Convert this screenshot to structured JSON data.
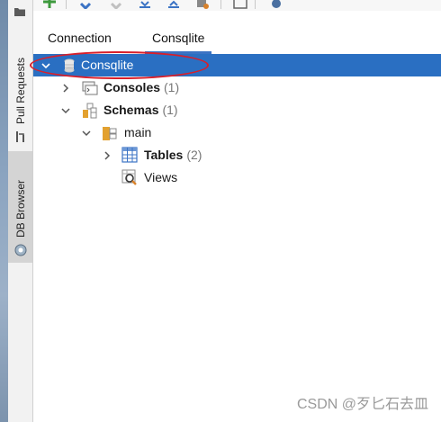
{
  "side_panel": {
    "pull_requests_label": "Pull Requests",
    "db_browser_label": "DB Browser"
  },
  "tabs": [
    {
      "label": "Connection"
    },
    {
      "label": "Consqlite"
    }
  ],
  "tree": {
    "root": {
      "label": "Consqlite"
    },
    "consoles": {
      "label": "Consoles",
      "count": "(1)"
    },
    "schemas": {
      "label": "Schemas",
      "count": "(1)"
    },
    "main": {
      "label": "main"
    },
    "tables": {
      "label": "Tables",
      "count": "(2)"
    },
    "views": {
      "label": "Views"
    }
  },
  "watermark": "CSDN @歹匕石去皿",
  "colors": {
    "selection": "#2a6fc2",
    "annotation_ellipse": "#d81f2a",
    "tab_underline": "#3b73c4"
  }
}
